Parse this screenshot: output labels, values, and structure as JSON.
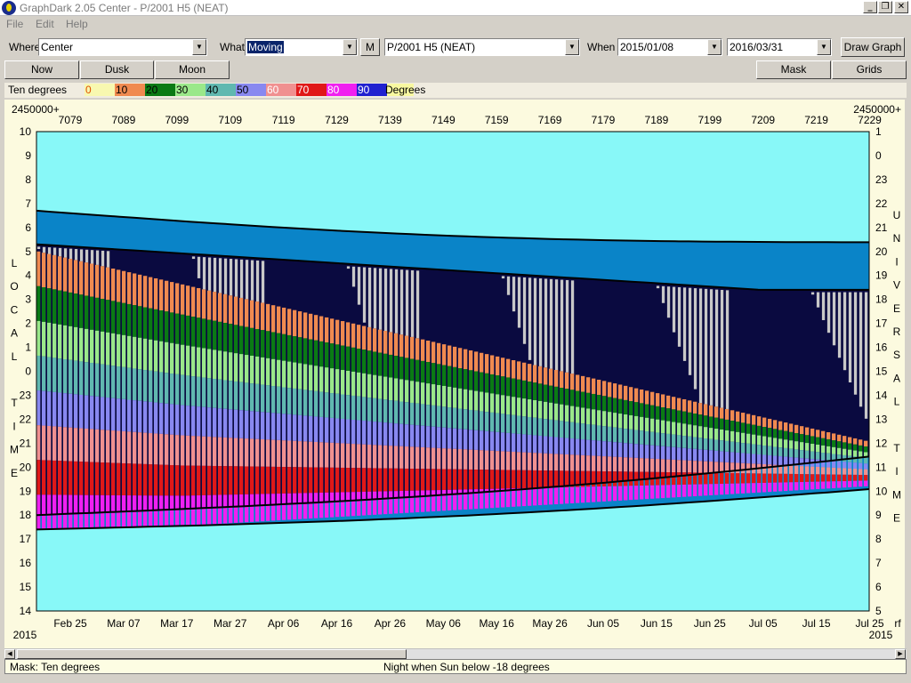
{
  "window": {
    "title": "GraphDark 2.05  Center  -  P/2001 H5 (NEAT)",
    "minimize": "_",
    "restore": "❐",
    "close": "✕"
  },
  "menu": [
    "File",
    "Edit",
    "Help"
  ],
  "toolbar": {
    "where_label": "Where",
    "where_value": "Center",
    "what_label": "What",
    "what_value": "Moving",
    "m_button": "M",
    "object_value": "P/2001 H5 (NEAT)",
    "when_label": "When",
    "start_date": "2015/01/08",
    "end_date": "2016/03/31",
    "draw_button": "Draw Graph"
  },
  "buttons": {
    "now": "Now",
    "dusk": "Dusk",
    "moon": "Moon",
    "mask": "Mask",
    "grids": "Grids"
  },
  "legend": {
    "title": "Ten degrees",
    "unit": "Degrees",
    "items": [
      {
        "label": "0",
        "color": "#f8f8b0"
      },
      {
        "label": "10",
        "color": "#f08a50"
      },
      {
        "label": "20",
        "color": "#0a7a14"
      },
      {
        "label": "30",
        "color": "#9ae88a"
      },
      {
        "label": "40",
        "color": "#60b8b0"
      },
      {
        "label": "50",
        "color": "#8888f0"
      },
      {
        "label": "60",
        "color": "#f09090"
      },
      {
        "label": "70",
        "color": "#e01818"
      },
      {
        "label": "80",
        "color": "#f020f0"
      },
      {
        "label": "90",
        "color": "#2020d0"
      }
    ],
    "trailing_color": "#f8f8a0"
  },
  "chart_data": {
    "type": "heatmap",
    "jd_label_left": "2450000+",
    "jd_label_right": "2450000+",
    "jd_ticks": [
      "7079",
      "7089",
      "7099",
      "7109",
      "7119",
      "7129",
      "7139",
      "7149",
      "7159",
      "7169",
      "7179",
      "7189",
      "7199",
      "7209",
      "7219",
      "7229"
    ],
    "date_ticks": [
      "Feb 25",
      "Mar 07",
      "Mar 17",
      "Mar 27",
      "Apr 06",
      "Apr 16",
      "Apr 26",
      "May 06",
      "May 16",
      "May 26",
      "Jun 05",
      "Jun 15",
      "Jun 25",
      "Jul 05",
      "Jul 15",
      "Jul 25"
    ],
    "year_left": "2015",
    "year_right": "2015",
    "corner_label": "rf",
    "local_time_ticks": [
      "10",
      "9",
      "8",
      "7",
      "6",
      "5",
      "4",
      "3",
      "2",
      "1",
      "0",
      "23",
      "22",
      "21",
      "20",
      "19",
      "18",
      "17",
      "16",
      "15",
      "14"
    ],
    "universal_time_ticks": [
      "1",
      "0",
      "23",
      "22",
      "21",
      "20",
      "19",
      "18",
      "17",
      "16",
      "15",
      "14",
      "13",
      "12",
      "11",
      "10",
      "9",
      "8",
      "7",
      "6",
      "5"
    ],
    "left_axis_letters": [
      "L",
      "O",
      "C",
      "A",
      "L",
      "",
      "T",
      "I",
      "M",
      "E"
    ],
    "right_axis_letters": [
      "U",
      "N",
      "I",
      "V",
      "E",
      "R",
      "S",
      "A",
      "L",
      "",
      "T",
      "I",
      "M",
      "E"
    ],
    "colors": {
      "background": "#88f8f8",
      "twilight": "#0a84c8",
      "night": "#0a0a40",
      "moon": "#c8c8c8",
      "bands": [
        "#f08a50",
        "#0a7a14",
        "#9ae88a",
        "#60b8b0",
        "#8888f0",
        "#f09090",
        "#e01818",
        "#f020f0"
      ]
    }
  },
  "status": {
    "left": "Mask:  Ten degrees",
    "center": "Night when Sun below -18 degrees"
  }
}
